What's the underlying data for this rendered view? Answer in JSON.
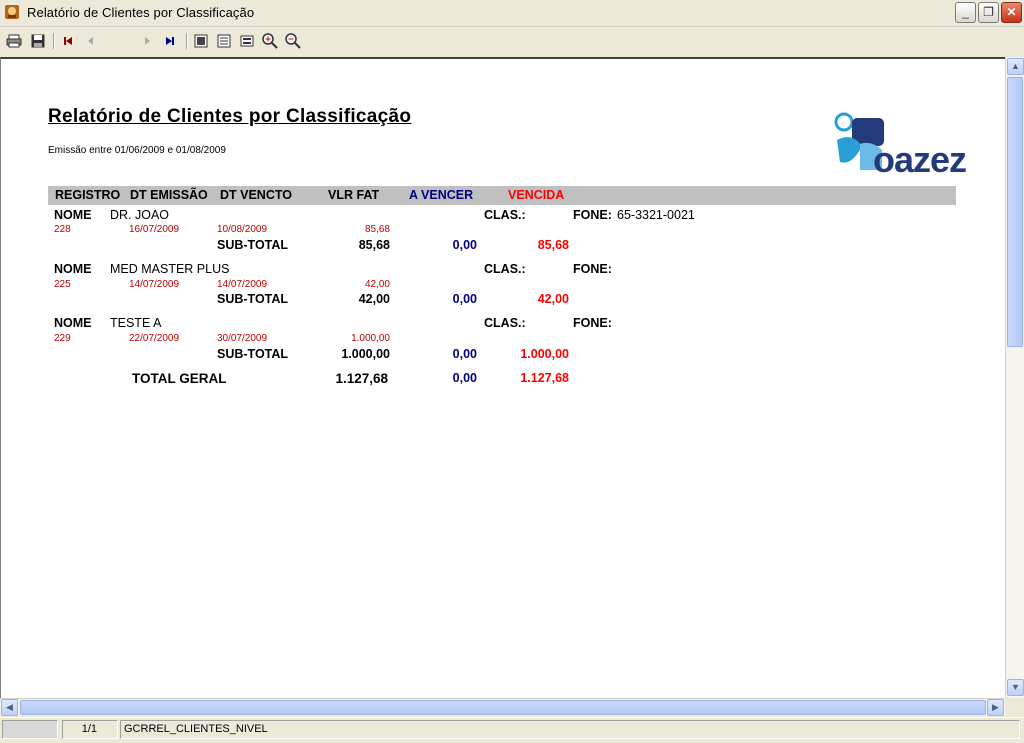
{
  "window": {
    "title": "Relatório de Clientes por Classificação"
  },
  "toolbar": {
    "page_value": ""
  },
  "report": {
    "title": "Relatório de Clientes por Classificação",
    "subtitle": "Emissão entre 01/06/2009 e 01/08/2009",
    "logo_text": "oazez",
    "headers": {
      "registro": "REGISTRO",
      "dt_emissao": "DT EMISSÃO",
      "dt_vencto": "DT VENCTO",
      "vlr_fat": "VLR FAT",
      "a_vencer": "A VENCER",
      "vencida": "VENCIDA"
    },
    "labels": {
      "nome": "NOME",
      "clas": "CLAS.:",
      "fone": "FONE:",
      "subtotal": "SUB-TOTAL",
      "total": "TOTAL GERAL"
    },
    "groups": [
      {
        "nome": "DR. JOAO",
        "fone": "65-3321-0021",
        "registro": "228",
        "dt_emissao": "16/07/2009",
        "dt_vencto": "10/08/2009",
        "vlr_fat": "85,68",
        "sub_vlr": "85,68",
        "sub_avencer": "0,00",
        "sub_vencida": "85,68"
      },
      {
        "nome": "MED MASTER PLUS",
        "fone": "",
        "registro": "225",
        "dt_emissao": "14/07/2009",
        "dt_vencto": "14/07/2009",
        "vlr_fat": "42,00",
        "sub_vlr": "42,00",
        "sub_avencer": "0,00",
        "sub_vencida": "42,00"
      },
      {
        "nome": "TESTE A",
        "fone": "",
        "registro": "229",
        "dt_emissao": "22/07/2009",
        "dt_vencto": "30/07/2009",
        "vlr_fat": "1.000,00",
        "sub_vlr": "1.000,00",
        "sub_avencer": "0,00",
        "sub_vencida": "1.000,00"
      }
    ],
    "total": {
      "vlr": "1.127,68",
      "avencer": "0,00",
      "vencida": "1.127,68"
    }
  },
  "statusbar": {
    "page": "1/1",
    "report_name": "GCRREL_CLIENTES_NIVEL"
  },
  "colors": {
    "vencida": "#ff0000",
    "a_vencer": "#000080",
    "detail": "#c00000"
  }
}
